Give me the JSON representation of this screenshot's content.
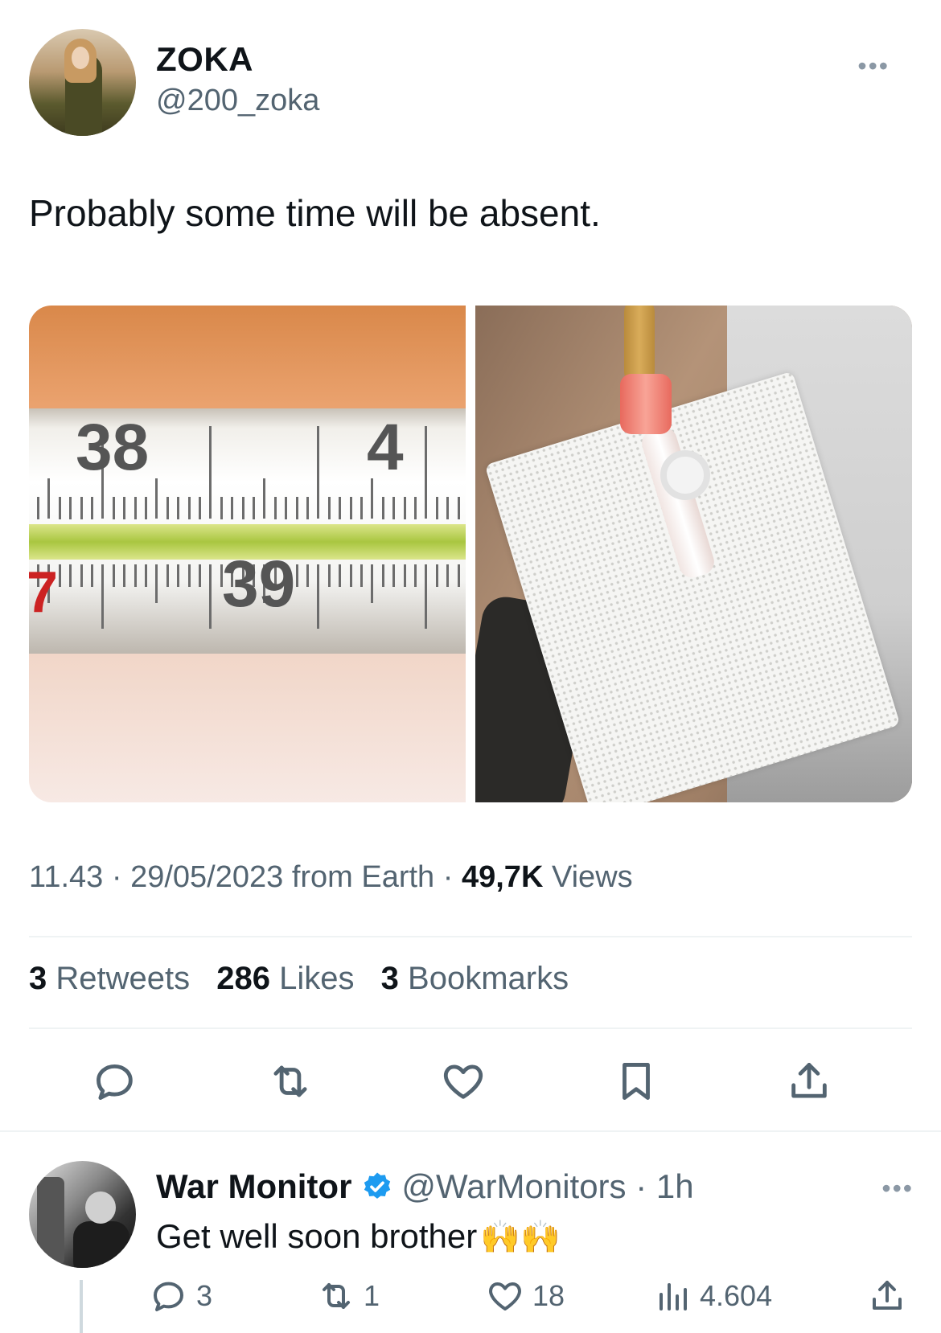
{
  "tweet": {
    "author": {
      "name": "ZOKA",
      "handle": "@200_zoka"
    },
    "text": "Probably some time will be absent.",
    "media": [
      {
        "description": "Thermometer showing about 38.9",
        "scale_labels": [
          "38",
          "4",
          "39",
          "7"
        ]
      },
      {
        "description": "IV cannula under bandage on arm"
      }
    ],
    "meta": {
      "time": "11.43",
      "date": "29/05/2023",
      "source": "from Earth",
      "views_count": "49,7K",
      "views_label": "Views"
    },
    "stats": {
      "retweets_count": "3",
      "retweets_label": "Retweets",
      "likes_count": "286",
      "likes_label": "Likes",
      "bookmarks_count": "3",
      "bookmarks_label": "Bookmarks"
    },
    "actions": [
      "reply-icon",
      "retweet-icon",
      "like-icon",
      "bookmark-icon",
      "share-icon"
    ]
  },
  "reply": {
    "author": {
      "name": "War Monitor",
      "handle": "@WarMonitors",
      "time": "1h",
      "verified": true
    },
    "text": "Get well soon brother",
    "emoji": "🙌🙌",
    "counts": {
      "replies": "3",
      "retweets": "1",
      "likes": "18",
      "views": "4.604"
    }
  },
  "colors": {
    "text_primary": "#0f1419",
    "text_secondary": "#536471",
    "verified_blue": "#1d9bf0",
    "divider": "#eff3f4"
  }
}
